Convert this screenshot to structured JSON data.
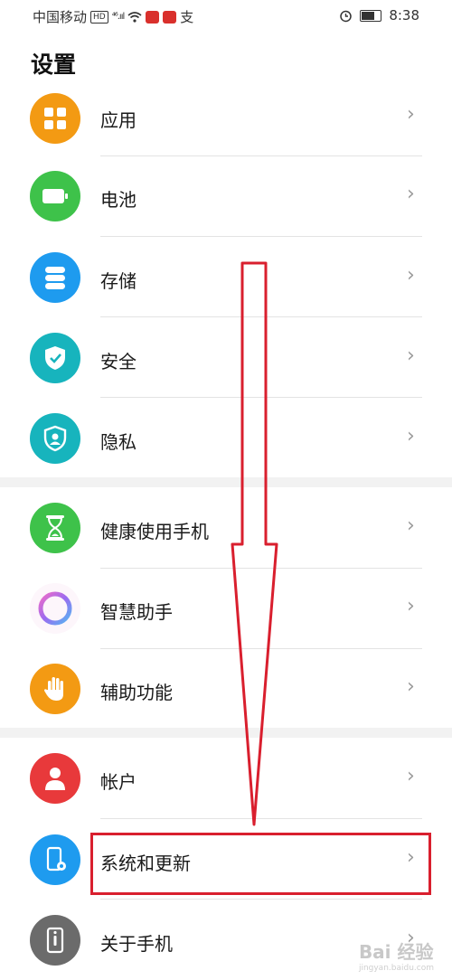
{
  "status_bar": {
    "carrier": "中国移动",
    "hd": "HD",
    "signal": "⁴⁶.ııl",
    "extra": "支",
    "time": "8:38",
    "battery_level": 0.6
  },
  "page": {
    "title": "设置"
  },
  "settings": [
    {
      "label": "应用",
      "icon": "apps-icon",
      "color": "#f39a13"
    },
    {
      "label": "电池",
      "icon": "battery-icon",
      "color": "#3ec24a"
    },
    {
      "label": "存储",
      "icon": "storage-icon",
      "color": "#1e9bef"
    },
    {
      "label": "安全",
      "icon": "shield-check-icon",
      "color": "#17b4bd"
    },
    {
      "label": "隐私",
      "icon": "privacy-icon",
      "color": "#17b4bd"
    },
    {
      "label": "健康使用手机",
      "icon": "hourglass-icon",
      "color": "#3ec24a"
    },
    {
      "label": "智慧助手",
      "icon": "assistant-ring-icon",
      "color": "#ffffff"
    },
    {
      "label": "辅助功能",
      "icon": "hand-icon",
      "color": "#f39a13"
    },
    {
      "label": "帐户",
      "icon": "account-icon",
      "color": "#e8393b"
    },
    {
      "label": "系统和更新",
      "icon": "system-update-icon",
      "color": "#1e9bef"
    },
    {
      "label": "关于手机",
      "icon": "phone-info-icon",
      "color": "#6b6b6b"
    }
  ],
  "chevron": "›",
  "watermark": {
    "main": "Bai 经验",
    "sub": "jingyan.baidu.com"
  }
}
